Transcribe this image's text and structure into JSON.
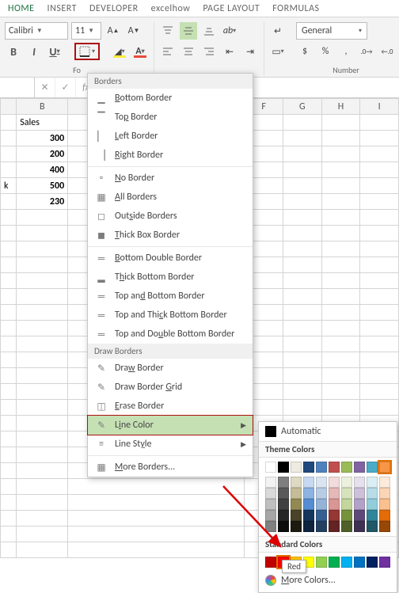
{
  "tabs": {
    "home": "HOME",
    "insert": "INSERT",
    "developer": "DEVELOPER",
    "excelhow": "excelhow",
    "pagelayout": "PAGE LAYOUT",
    "formulas": "FORMULAS"
  },
  "font": {
    "name": "Calibri",
    "size": "11"
  },
  "fontbuttons": {
    "bold": "B",
    "italic": "I",
    "underline": "U"
  },
  "number": {
    "format": "General",
    "group_label": "Number"
  },
  "font_group_label": "Fo",
  "columns": [
    "B",
    "F",
    "G",
    "H",
    "I"
  ],
  "cell": {
    "sales_hdr": "Sales",
    "k": "k"
  },
  "values": [
    "300",
    "200",
    "400",
    "500",
    "230"
  ],
  "borders_menu": {
    "header_borders": "Borders",
    "bottom": "Bottom Border",
    "top": "Top Border",
    "left": "Left Border",
    "right": "Right Border",
    "none": "No Border",
    "all": "All Borders",
    "outside": "Outside Borders",
    "thickbox": "Thick Box Border",
    "dbl_bottom": "Bottom Double Border",
    "thick_bottom": "Thick Bottom Border",
    "top_bottom": "Top and Bottom Border",
    "top_thick_bottom": "Top and Thick Bottom Border",
    "top_dbl_bottom": "Top and Double Bottom Border",
    "header_draw": "Draw Borders",
    "draw_border": "Draw Border",
    "draw_grid": "Draw Border Grid",
    "erase": "Erase Border",
    "line_color": "Line Color",
    "line_style": "Line Style",
    "more": "More Borders..."
  },
  "colorfly": {
    "automatic": "Automatic",
    "theme_hdr": "Theme Colors",
    "standard_hdr": "Standard Colors",
    "more": "More Colors...",
    "tooltip": "Red"
  },
  "theme_row1": [
    "#ffffff",
    "#000000",
    "#eeece1",
    "#1f497d",
    "#4f81bd",
    "#c0504d",
    "#9bbb59",
    "#8064a2",
    "#4bacc6",
    "#f79646"
  ],
  "theme_shades": [
    [
      "#f2f2f2",
      "#7f7f7f",
      "#ddd9c3",
      "#c6d9f0",
      "#dbe5f1",
      "#f2dcdb",
      "#ebf1dd",
      "#e5e0ec",
      "#dbeef3",
      "#fdeada"
    ],
    [
      "#d9d9d9",
      "#595959",
      "#c4bd97",
      "#8db3e2",
      "#b8cce4",
      "#e5b9b7",
      "#d7e3bc",
      "#ccc1d9",
      "#b7dde8",
      "#fbd5b5"
    ],
    [
      "#bfbfbf",
      "#404040",
      "#938953",
      "#548dd4",
      "#95b3d7",
      "#d99694",
      "#c3d69b",
      "#b2a2c7",
      "#92cddc",
      "#fac08f"
    ],
    [
      "#a6a6a6",
      "#262626",
      "#494429",
      "#17365d",
      "#366092",
      "#953734",
      "#76923c",
      "#5f497a",
      "#31859b",
      "#e36c09"
    ],
    [
      "#808080",
      "#0d0d0d",
      "#1d1b10",
      "#0f243e",
      "#244061",
      "#632423",
      "#4f6128",
      "#3f3151",
      "#205867",
      "#974806"
    ]
  ],
  "standard_colors": [
    "#c00000",
    "#ff0000",
    "#ffc000",
    "#ffff00",
    "#92d050",
    "#00b050",
    "#00b0f0",
    "#0070c0",
    "#002060",
    "#7030a0"
  ]
}
